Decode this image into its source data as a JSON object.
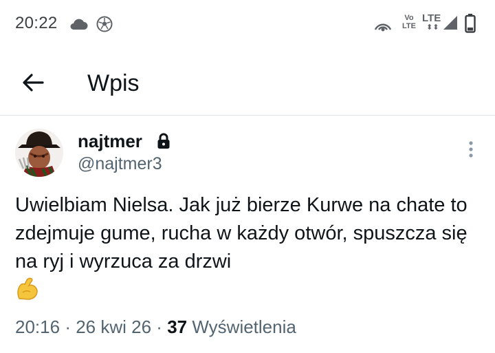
{
  "status_bar": {
    "time": "20:22",
    "icons": [
      "cloud-icon",
      "soccer-ball-icon",
      "hotspot-icon",
      "volte-icon",
      "lte-signal-icon",
      "battery-icon"
    ],
    "volte_top": "Vo",
    "volte_bottom": "LTE",
    "network": "LTE"
  },
  "app_bar": {
    "back_icon": "arrow-left-icon",
    "title": "Wpis"
  },
  "post": {
    "display_name": "najtmer",
    "handle": "@najtmer3",
    "protected_icon": "lock-icon",
    "more_icon": "vertical-dots-icon",
    "text": "Uwielbiam Nielsa. Jak już bierze Kurwe na chate to zdejmuje gume, rucha w każdy otwór, spuszcza się na ryj i wyrzuca za drzwi",
    "emoji": "flexed-biceps-emoji",
    "time": "20:16",
    "date": "26 kwi 26",
    "separator": "·",
    "views_count": "37",
    "views_label": "Wyświetlenia"
  },
  "colors": {
    "text_primary": "#0f1419",
    "text_secondary": "#536471",
    "divider": "#dfe3e6",
    "status_icons": "#3c4043"
  }
}
